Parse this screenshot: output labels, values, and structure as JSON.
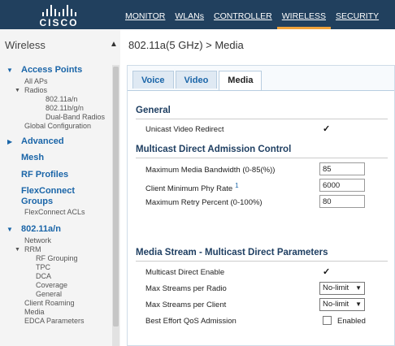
{
  "brand": {
    "name": "CISCO"
  },
  "topnav": {
    "items": [
      {
        "label": "MONITOR",
        "active": false
      },
      {
        "label": "WLANs",
        "active": false
      },
      {
        "label": "CONTROLLER",
        "active": false
      },
      {
        "label": "WIRELESS",
        "active": true
      },
      {
        "label": "SECURITY",
        "active": false
      }
    ]
  },
  "sidebar": {
    "title": "Wireless",
    "collapse_icon": "caret-up-icon",
    "access_points": "Access Points",
    "all_aps": "All APs",
    "radios": "Radios",
    "radio_a": "802.11a/n",
    "radio_bg": "802.11b/g/n",
    "dual_band": "Dual-Band Radios",
    "global_config": "Global Configuration",
    "advanced": "Advanced",
    "mesh": "Mesh",
    "rf_profiles": "RF Profiles",
    "flexconnect_groups": "FlexConnect Groups",
    "flexconnect_acls": "FlexConnect ACLs",
    "band": "802.11a/n",
    "network": "Network",
    "rrm": "RRM",
    "rf_grouping": "RF Grouping",
    "tpc": "TPC",
    "dca": "DCA",
    "coverage": "Coverage",
    "general": "General",
    "client_roaming": "Client Roaming",
    "media": "Media",
    "edca": "EDCA Parameters"
  },
  "main": {
    "title": "802.11a(5 GHz) > Media",
    "tabs": [
      {
        "label": "Voice",
        "active": false
      },
      {
        "label": "Video",
        "active": false
      },
      {
        "label": "Media",
        "active": true
      }
    ],
    "general": {
      "heading": "General",
      "unicast_video_redirect_label": "Unicast Video Redirect",
      "unicast_video_redirect": true
    },
    "mdac": {
      "heading": "Multicast Direct Admission Control",
      "max_bandwidth_label": "Maximum Media Bandwidth (0-85(%))",
      "max_bandwidth": "85",
      "client_min_phy_label": "Client Minimum Phy Rate",
      "client_min_phy_info": "1",
      "client_min_phy": "6000",
      "max_retry_label": "Maximum Retry Percent (0-100%)",
      "max_retry": "80"
    },
    "stream": {
      "heading": "Media Stream - Multicast Direct Parameters",
      "multicast_direct_label": "Multicast Direct Enable",
      "multicast_direct": true,
      "max_streams_radio_label": "Max Streams per Radio",
      "max_streams_radio": "No-limit",
      "max_streams_client_label": "Max Streams per Client",
      "max_streams_client": "No-limit",
      "best_effort_label": "Best Effort QoS Admission",
      "best_effort": false,
      "best_effort_text": "Enabled"
    }
  }
}
